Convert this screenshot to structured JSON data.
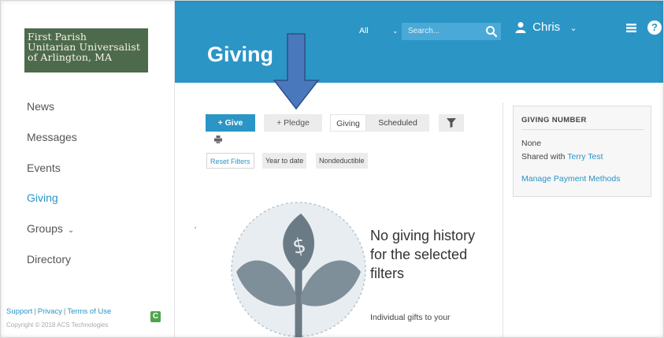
{
  "org": {
    "logo_text": "First Parish\nUnitarian Universalist\nof Arlington, MA"
  },
  "sidebar": {
    "items": [
      {
        "label": "News"
      },
      {
        "label": "Messages"
      },
      {
        "label": "Events"
      },
      {
        "label": "Giving",
        "active": true
      },
      {
        "label": "Groups",
        "has_dropdown": true
      },
      {
        "label": "Directory"
      }
    ],
    "footer": {
      "support": "Support",
      "sep": "|",
      "privacy": "Privacy",
      "terms": "Terms of Use",
      "copyright": "Copyright © 2018 ACS Technologies",
      "badge": "C"
    }
  },
  "header": {
    "title": "Giving",
    "search_scope": "All",
    "search_placeholder": "Search...",
    "user_name": "Chris",
    "help": "?"
  },
  "toolbar": {
    "give_label": "+ Give",
    "pledge_label": "+ Pledge",
    "tabs": [
      "Giving",
      "Scheduled"
    ],
    "active_tab": "Giving"
  },
  "filters": {
    "reset": "Reset Filters",
    "chips": [
      "Year to date",
      "Nondeductible"
    ]
  },
  "empty_state": {
    "title": "No giving history for the selected filters",
    "subtitle": "Individual gifts to your"
  },
  "giving_number": {
    "title": "GIVING NUMBER",
    "value": "None",
    "shared_prefix": "Shared with",
    "shared_name": "Terry Test",
    "manage_link": "Manage Payment Methods"
  },
  "colors": {
    "header_blue": "#2b95c6",
    "logo_green": "#4e6a4c",
    "link_blue": "#2a93c5",
    "annotation_arrow": "#4a78bd"
  }
}
